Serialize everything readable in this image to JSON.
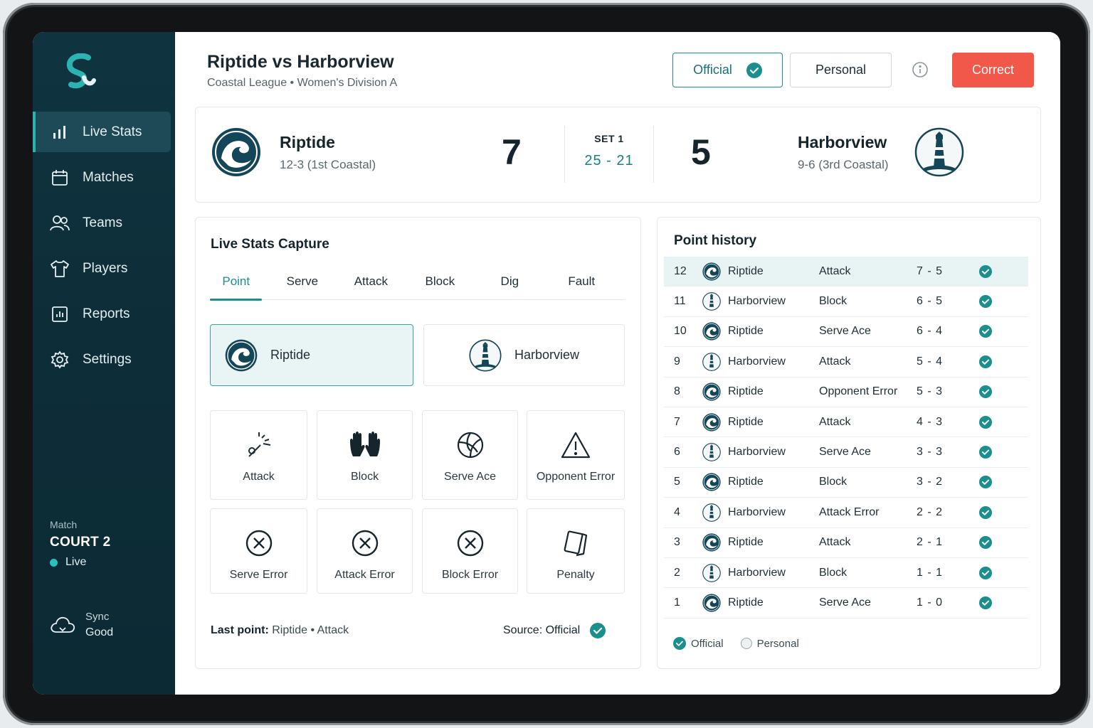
{
  "sidebar": {
    "items": [
      {
        "label": "Live Stats",
        "icon": "bar-chart-icon",
        "active": true
      },
      {
        "label": "Matches",
        "icon": "calendar-icon"
      },
      {
        "label": "Teams",
        "icon": "users-icon"
      },
      {
        "label": "Players",
        "icon": "jersey-icon"
      },
      {
        "label": "Reports",
        "icon": "report-icon"
      },
      {
        "label": "Settings",
        "icon": "gear-icon"
      }
    ],
    "match_label": "Match",
    "court": "COURT 2",
    "live": "Live",
    "sync_label": "Sync",
    "sync_status": "Good"
  },
  "header": {
    "title": "Riptide vs Harborview",
    "subtitle": "Coastal League • Women's Division A",
    "official": "Official",
    "personal": "Personal",
    "correct": "Correct"
  },
  "score": {
    "home": {
      "name": "Riptide",
      "record": "12-3 (1st Coastal)",
      "points": "7"
    },
    "away": {
      "name": "Harborview",
      "record": "9-6 (3rd Coastal)",
      "points": "5"
    },
    "set_label": "SET 1",
    "set_score": "25 - 21"
  },
  "capture": {
    "title": "Live Stats Capture",
    "tabs": [
      "Point",
      "Serve",
      "Attack",
      "Block",
      "Dig",
      "Fault"
    ],
    "team_a": "Riptide",
    "team_b": "Harborview",
    "actions": [
      "Attack",
      "Block",
      "Serve Ace",
      "Opponent Error",
      "Serve Error",
      "Attack Error",
      "Block Error",
      "Penalty"
    ],
    "last_point_label": "Last point:",
    "last_point_value": "Riptide • Attack",
    "source_label": "Source:",
    "source_value": "Official"
  },
  "history": {
    "title": "Point history",
    "rows": [
      {
        "n": "12",
        "team": "Riptide",
        "action": "Attack",
        "score": "7 - 5"
      },
      {
        "n": "11",
        "team": "Harborview",
        "action": "Block",
        "score": "6 - 5"
      },
      {
        "n": "10",
        "team": "Riptide",
        "action": "Serve Ace",
        "score": "6 - 4"
      },
      {
        "n": "9",
        "team": "Harborview",
        "action": "Attack",
        "score": "5 - 4"
      },
      {
        "n": "8",
        "team": "Riptide",
        "action": "Opponent Error",
        "score": "5 - 3"
      },
      {
        "n": "7",
        "team": "Riptide",
        "action": "Attack",
        "score": "4 - 3"
      },
      {
        "n": "6",
        "team": "Harborview",
        "action": "Serve Ace",
        "score": "3 - 3"
      },
      {
        "n": "5",
        "team": "Riptide",
        "action": "Block",
        "score": "3 - 2"
      },
      {
        "n": "4",
        "team": "Harborview",
        "action": "Attack Error",
        "score": "2 - 2"
      },
      {
        "n": "3",
        "team": "Riptide",
        "action": "Attack",
        "score": "2 - 1"
      },
      {
        "n": "2",
        "team": "Harborview",
        "action": "Block",
        "score": "1 - 1"
      },
      {
        "n": "1",
        "team": "Riptide",
        "action": "Serve Ace",
        "score": "1 - 0"
      }
    ],
    "legend_official": "Official",
    "legend_personal": "Personal"
  },
  "colors": {
    "accent": "#1b8e8e",
    "correct": "#f2584a",
    "sidebar": "#0f3440"
  }
}
